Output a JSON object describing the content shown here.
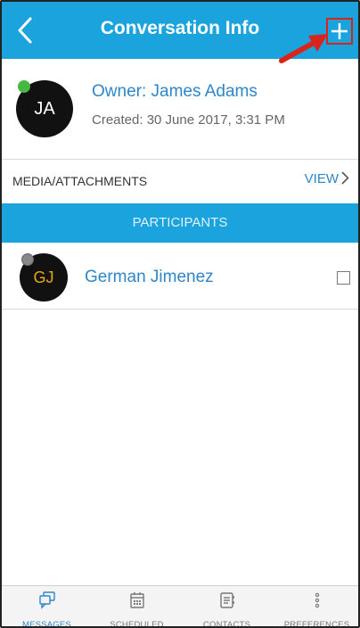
{
  "header": {
    "title": "Conversation Info",
    "back_icon": "chevron-left-icon",
    "add_icon": "plus-icon"
  },
  "owner": {
    "initials": "JA",
    "name": "Owner: James Adams",
    "created": "Created: 30 June 2017, 3:31 PM",
    "status_color": "#47b742"
  },
  "media": {
    "label": "MEDIA/ATTACHMENTS",
    "view_label": "VIEW"
  },
  "participants": {
    "header": "PARTICIPANTS",
    "items": [
      {
        "initials": "GJ",
        "name": "German Jimenez",
        "checked": false,
        "status_color": "#888888"
      }
    ]
  },
  "tabbar": {
    "items": [
      {
        "label": "MESSAGES",
        "icon": "messages-icon",
        "active": true
      },
      {
        "label": "SCHEDULED",
        "icon": "calendar-icon",
        "active": false
      },
      {
        "label": "CONTACTS",
        "icon": "contacts-icon",
        "active": false
      },
      {
        "label": "PREFERENCES",
        "icon": "more-vertical-icon",
        "active": false
      }
    ]
  },
  "colors": {
    "accent": "#1aa3dd",
    "link": "#2e86c9",
    "annotation_red": "#d9241c"
  }
}
